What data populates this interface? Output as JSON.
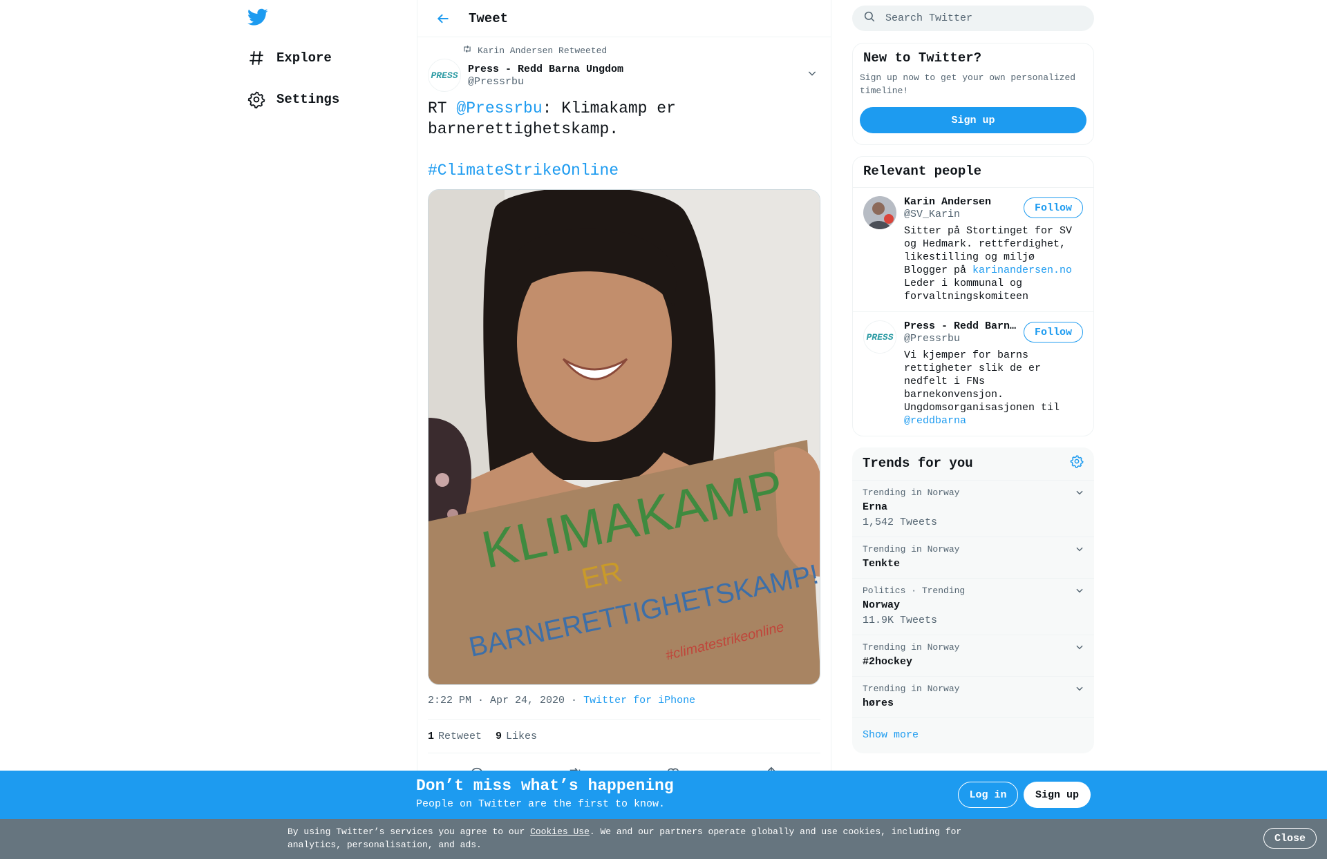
{
  "nav": {
    "logo_icon": "twitter-bird-icon",
    "items": [
      {
        "label": "Explore",
        "icon": "hashtag-icon"
      },
      {
        "label": "Settings",
        "icon": "gear-icon"
      }
    ]
  },
  "header": {
    "title": "Tweet",
    "back_icon": "arrow-left-icon"
  },
  "tweet": {
    "retweeted_by": "Karin Andersen Retweeted",
    "author": {
      "name": "Press - Redd Barna Ungdom",
      "handle": "@Pressrbu",
      "avatar_text": "PRESS"
    },
    "text": {
      "prefix": "RT ",
      "mention": "@Pressrbu",
      "body": ": Klimakamp er barnerettighetskamp.",
      "hashtag": "#ClimateStrikeOnline"
    },
    "media": {
      "line1": "KLIMAKAMP",
      "line2": "ER",
      "line3": "BARNERETTIGHETSKAMP!",
      "line4": "#climatestrikeonline"
    },
    "timestamp": "2:22 PM · Apr 24, 2020",
    "separator": " · ",
    "source": "Twitter for iPhone",
    "retweets": {
      "count": "1",
      "label": "Retweet"
    },
    "likes": {
      "count": "9",
      "label": "Likes"
    }
  },
  "search": {
    "placeholder": "Search Twitter"
  },
  "signup_card": {
    "title": "New to Twitter?",
    "text": "Sign up now to get your own personalized timeline!",
    "button": "Sign up"
  },
  "people": {
    "title": "Relevant people",
    "items": [
      {
        "name": "Karin Andersen",
        "handle": "@SV_Karin",
        "follow": "Follow",
        "bio_before": "Sitter på Stortinget for SV og Hedmark. rettferdighet, likestilling og miljø\nBlogger på ",
        "bio_link": "karinandersen.no",
        "bio_after": "\nLeder i kommunal og forvaltningskomiteen"
      },
      {
        "name": "Press - Redd Barna Ungdom",
        "handle": "@Pressrbu",
        "follow": "Follow",
        "bio_before": "Vi kjemper for barns rettigheter slik de er nedfelt i FNs barnekonvensjon. Ungdomsorganisasjonen til ",
        "bio_link": "@reddbarna",
        "bio_after": ""
      }
    ]
  },
  "trends": {
    "title": "Trends for you",
    "items": [
      {
        "context": "Trending in Norway",
        "name": "Erna",
        "count": "1,542 Tweets"
      },
      {
        "context": "Trending in Norway",
        "name": "Tenkte",
        "count": ""
      },
      {
        "context": "Politics · Trending",
        "name": "Norway",
        "count": "11.9K Tweets"
      },
      {
        "context": "Trending in Norway",
        "name": "#2hockey",
        "count": ""
      },
      {
        "context": "Trending in Norway",
        "name": "høres",
        "count": ""
      }
    ],
    "show_more": "Show more"
  },
  "banner": {
    "title": "Don’t miss what’s happening",
    "subtitle": "People on Twitter are the first to know.",
    "login": "Log in",
    "signup": "Sign up"
  },
  "cookie": {
    "before": "By using Twitter’s services you agree to our ",
    "link": "Cookies Use",
    "after": ". We and our partners operate globally and use cookies, including for analytics, personalisation, and ads.",
    "close": "Close"
  },
  "colors": {
    "accent": "#1d9bf0",
    "banner": "#1d9bf0",
    "cookie_bar": "#66757f"
  }
}
